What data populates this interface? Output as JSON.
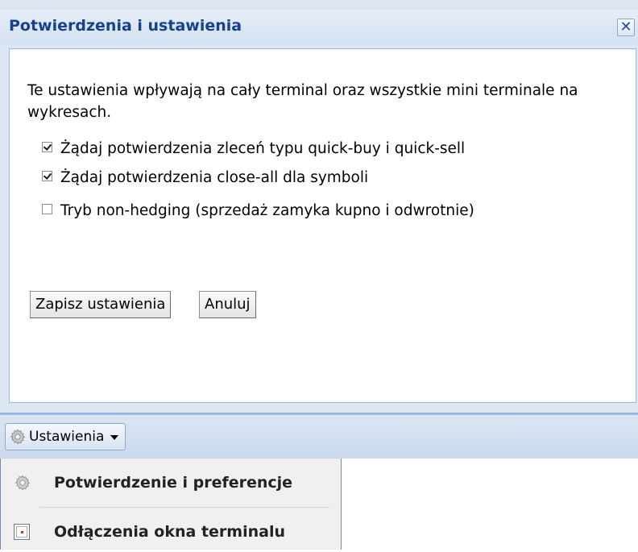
{
  "dialog": {
    "title": "Potwierdzenia i ustawienia",
    "close_glyph": "✕",
    "info_text": "Te ustawienia wpływają na cały terminal oraz wszystkie mini terminale na wykresach.",
    "options": [
      {
        "label": "Żądaj potwierdzenia zleceń typu quick-buy i quick-sell",
        "checked": true
      },
      {
        "label": "Żądaj potwierdzenia close-all dla symboli",
        "checked": true
      },
      {
        "label": "Tryb non-hedging (sprzedaż zamyka kupno i odwrotnie)",
        "checked": false
      }
    ],
    "save_label": "Zapisz ustawienia",
    "cancel_label": "Anuluj"
  },
  "toolbar": {
    "settings_label": "Ustawienia",
    "settings_icon": "gear-icon"
  },
  "menu": {
    "items": [
      {
        "label": "Potwierdzenie i preferencje",
        "icon": "gear-icon"
      },
      {
        "label": "Odłączenia okna terminalu",
        "icon": "window-icon"
      }
    ]
  },
  "colors": {
    "title_blue": "#15428b",
    "panel_bg": "#dde7f2",
    "border_blue": "#99bbe8"
  }
}
